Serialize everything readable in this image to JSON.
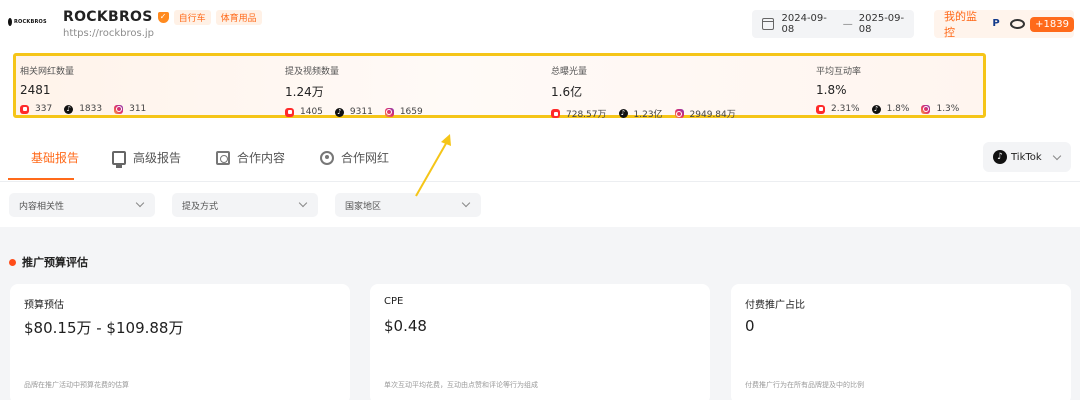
{
  "header": {
    "logo_text": "ROCKBROS",
    "brand_name": "ROCKBROS",
    "tags": [
      "自行车",
      "体育用品"
    ],
    "url": "https://rockbros.jp",
    "date_start": "2024-09-08",
    "date_sep": "—",
    "date_end": "2025-09-08",
    "monitor_label": "我的监控",
    "monitor_count": "+1839"
  },
  "stats": [
    {
      "label": "相关网红数量",
      "value": "2481",
      "youtube": "337",
      "tiktok": "1833",
      "instagram": "311"
    },
    {
      "label": "提及视频数量",
      "value": "1.24万",
      "youtube": "1405",
      "tiktok": "9311",
      "instagram": "1659"
    },
    {
      "label": "总曝光量",
      "value": "1.6亿",
      "youtube": "728.57万",
      "tiktok": "1.23亿",
      "instagram": "2949.84万"
    },
    {
      "label": "平均互动率",
      "value": "1.8%",
      "youtube": "2.31%",
      "tiktok": "1.8%",
      "instagram": "1.3%"
    }
  ],
  "tabs": [
    {
      "label": "基础报告",
      "active": true
    },
    {
      "label": "高级报告",
      "active": false
    },
    {
      "label": "合作内容",
      "active": false
    },
    {
      "label": "合作网红",
      "active": false
    }
  ],
  "platform_select": "TikTok",
  "filters": [
    "内容相关性",
    "提及方式",
    "国家地区"
  ],
  "section": {
    "title": "推广预算评估"
  },
  "cards": [
    {
      "title": "预算预估",
      "value": "$80.15万 - $109.88万",
      "desc": "品牌在推广活动中预算花费的估算"
    },
    {
      "title": "CPE",
      "value": "$0.48",
      "desc": "单次互动平均花费，互动由点赞和评论等行为组成"
    },
    {
      "title": "付费推广占比",
      "value": "0",
      "desc": "付费推广行为在所有品牌提及中的比例"
    }
  ],
  "colors": {
    "accent": "#ff6a1a",
    "highlight_border": "#f5c518",
    "section_dot": "#ff4d1a"
  },
  "icons": {
    "youtube": "youtube-icon",
    "tiktok": "tiktok-icon",
    "instagram": "instagram-icon"
  }
}
